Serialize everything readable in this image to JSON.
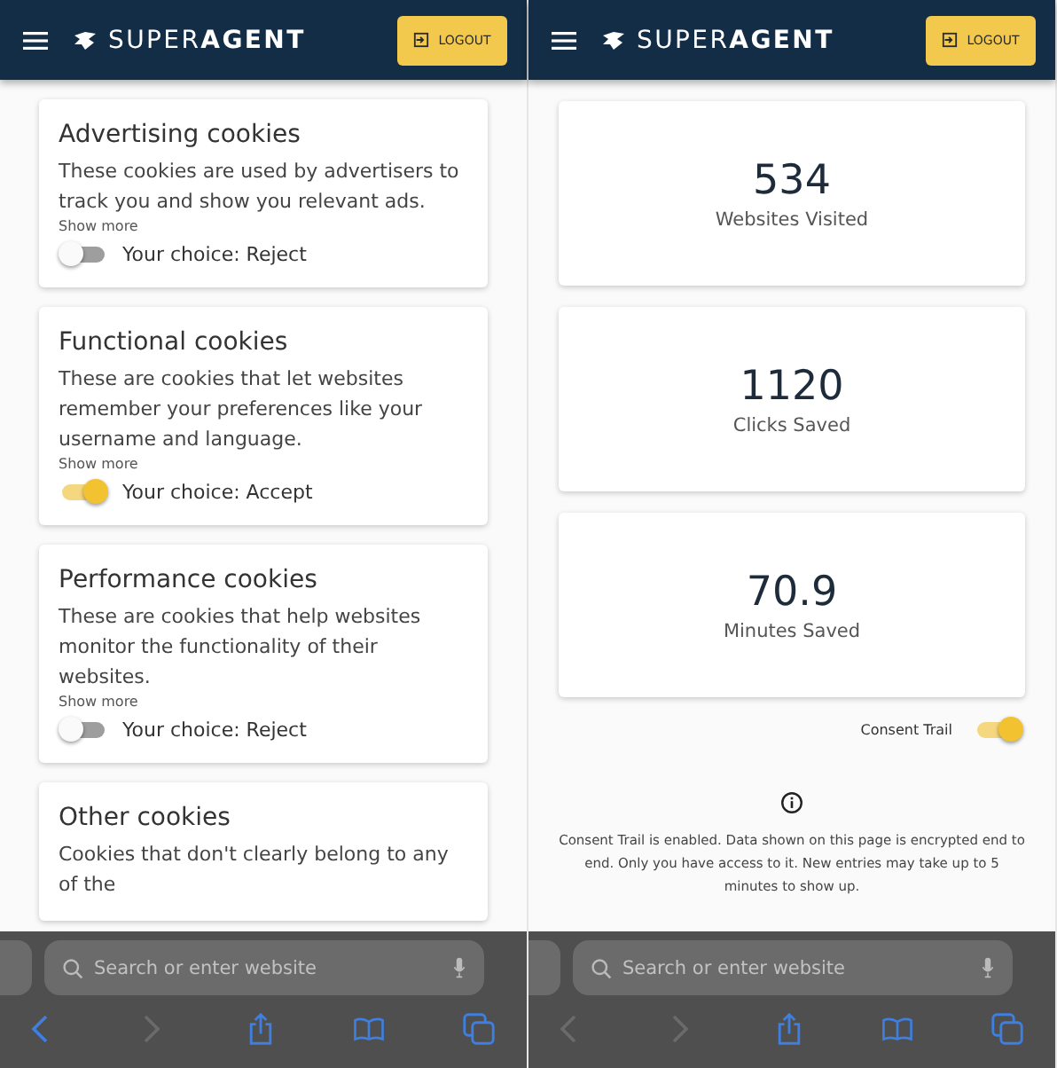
{
  "screens": [
    {
      "header": {
        "logo": "SUPER**AGENT**",
        "logout": "LOGOUT"
      },
      "kind": "cookies",
      "cookies": [
        {
          "title": "Advertising cookies",
          "description": "These cookies are used by advertisers to track you and show you relevant ads.",
          "show_more": "Show more",
          "choice": "Your choice: Reject",
          "checked": false
        },
        {
          "title": "Functional cookies",
          "description": "These are cookies that let websites remember your preferences like your username and language.",
          "show_more": "Show more",
          "choice": "Your choice: Accept",
          "checked": true
        },
        {
          "title": "Performance cookies",
          "description": "These are cookies that help websites monitor the functionality of their websites.",
          "show_more": "Show more",
          "choice": "Your choice: Reject",
          "checked": false
        },
        {
          "title": "Other cookies",
          "description": "Cookies that don't clearly belong to any of the"
        }
      ],
      "browser": {
        "search_placeholder": "Search or enter website",
        "back_enabled": true,
        "forward_enabled": false
      }
    },
    {
      "header": {
        "logo": "SUPER**AGENT**",
        "logout": "LOGOUT"
      },
      "kind": "stats",
      "stats": [
        {
          "value": "534",
          "label": "Websites Visited"
        },
        {
          "value": "1120",
          "label": "Clicks Saved"
        },
        {
          "value": "70.9",
          "label": "Minutes Saved"
        }
      ],
      "consent_trail": {
        "label": "Consent Trail",
        "checked": true
      },
      "info": "Consent Trail is enabled. Data shown on this page is encrypted end to end. Only you have access to it. New entries may take up to 5 minutes to show up.",
      "browser": {
        "search_placeholder": "Search or enter website",
        "back_enabled": false,
        "forward_enabled": false
      }
    }
  ]
}
